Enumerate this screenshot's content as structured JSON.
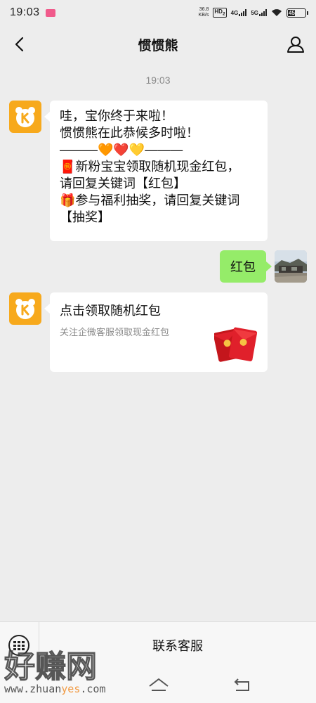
{
  "status_bar": {
    "time": "19:03",
    "net_speed_value": "36.8",
    "net_speed_unit": "KB/s",
    "hd_label": "HD",
    "hd_sub": "2",
    "net_4g": "4G",
    "net_5g": "5G",
    "battery_level": "45"
  },
  "header": {
    "title": "惯惯熊"
  },
  "chat": {
    "timestamp": "19:03",
    "messages": [
      {
        "sender": "bot",
        "lines": [
          "哇，宝你终于来啦！",
          "惯惯熊在此恭候多时啦！",
          "———🧡❤️💛———",
          "🧧新粉宝宝领取随机现金红包，",
          "请回复关键词【红包】",
          "🎁参与福利抽奖，请回复关键词",
          "【抽奖】"
        ]
      },
      {
        "sender": "user",
        "text": "红包"
      },
      {
        "sender": "bot",
        "card_title": "点击领取随机红包",
        "card_desc": "关注企微客服领取现金红包"
      }
    ]
  },
  "bottom_bar": {
    "menu_label": "联系客服"
  },
  "watermark": {
    "text_main": "好赚网",
    "text_url_1": "www.zhuan",
    "text_url_2": "yes",
    "text_url_3": ".com"
  },
  "colors": {
    "background": "#ededed",
    "bubble_self": "#95ec69",
    "bot_avatar": "#f7a91c",
    "redpacket": "#e0202b"
  }
}
